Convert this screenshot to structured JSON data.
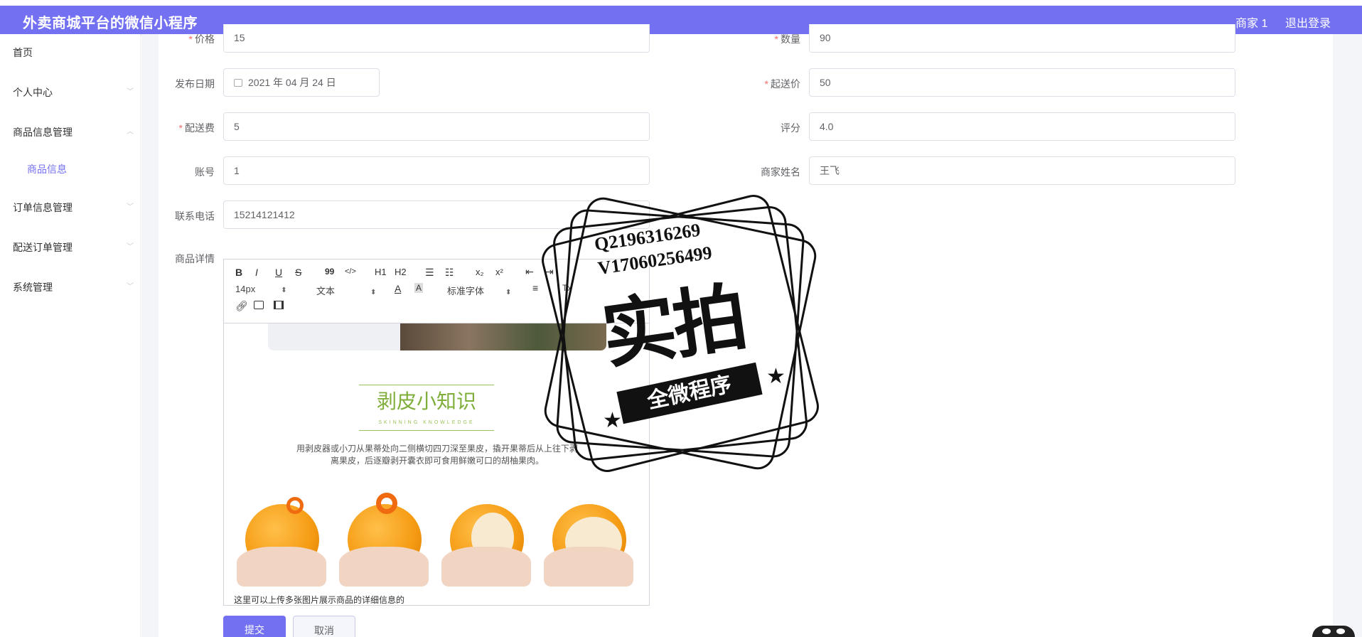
{
  "header": {
    "title": "外卖商城平台的微信小程序",
    "user": "商家 1",
    "logout": "退出登录"
  },
  "sidebar": {
    "items": [
      {
        "label": "首页"
      },
      {
        "label": "个人中心"
      },
      {
        "label": "商品信息管理"
      },
      {
        "label": "商品信息"
      },
      {
        "label": "订单信息管理"
      },
      {
        "label": "配送订单管理"
      },
      {
        "label": "系统管理"
      }
    ]
  },
  "form": {
    "price": {
      "label": "价格",
      "value": "15"
    },
    "quantity": {
      "label": "数量",
      "value": "90"
    },
    "publish_date": {
      "label": "发布日期",
      "value": "2021 年 04 月 24 日"
    },
    "min_order": {
      "label": "起送价",
      "value": "50"
    },
    "delivery_fee": {
      "label": "配送费",
      "value": "5"
    },
    "rating": {
      "label": "评分",
      "value": "4.0"
    },
    "account": {
      "label": "账号",
      "value": "1"
    },
    "merchant_name": {
      "label": "商家姓名",
      "value": "王飞"
    },
    "phone": {
      "label": "联系电话",
      "value": "15214121412"
    },
    "detail": {
      "label": "商品详情"
    },
    "required_mark": "*",
    "submit": "提交",
    "cancel": "取消"
  },
  "editor": {
    "toolbar": {
      "bold": "B",
      "italic": "I",
      "underline": "U",
      "strike": "S",
      "quote": "99",
      "code": "</>",
      "h1": "H1",
      "h2": "H2",
      "ol": "☰",
      "ul": "☷",
      "sub": "x₂",
      "sup": "x²",
      "indent_dec": "⇤",
      "indent_inc": "⇥",
      "size": "14px",
      "header": "文本",
      "font_color": "A",
      "bg_color": "A",
      "font": "标准字体",
      "align": "≡",
      "clean": "Tx"
    },
    "content": {
      "knowledge_title": "剥皮小知识",
      "knowledge_sub": "SKINNING KNOWLEDGE",
      "desc_line1": "用剥皮器或小刀从果蒂处向二侧横切四刀深至果皮，撬开果蒂后从上往下剥",
      "desc_line2": "离果皮，后逐瓣剥开囊衣即可食用鲜嫩可口的胡柚果肉。",
      "note": "这里可以上传多张图片展示商品的详细信息的"
    }
  },
  "watermark": {
    "line1": "Q2196316269",
    "line2": "V17060256499",
    "big": "实拍",
    "ribbon": "全微程序"
  },
  "colors": {
    "brand": "#7370f2",
    "required": "#f56c6c",
    "border": "#dcdfe6"
  }
}
